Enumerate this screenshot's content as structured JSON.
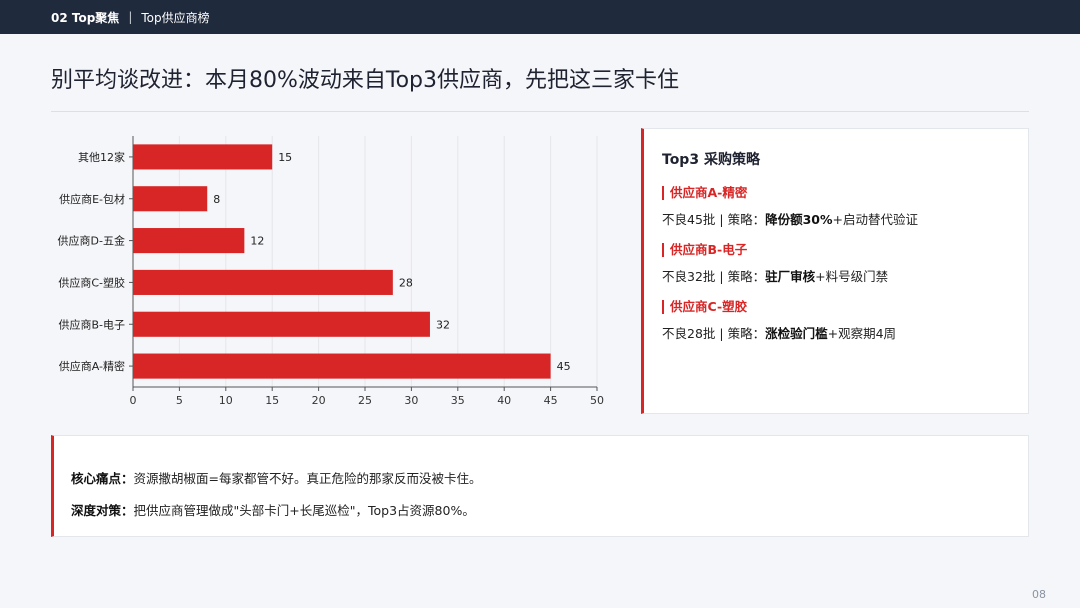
{
  "header": {
    "section": "02 Top聚焦",
    "separator": "|",
    "subtitle": "Top供应商榜"
  },
  "title": "别平均谈改进：本月80%波动来自Top3供应商，先把这三家卡住",
  "chart_data": {
    "type": "bar",
    "orientation": "horizontal",
    "categories": [
      "其他12家",
      "供应商E-包材",
      "供应商D-五金",
      "供应商C-塑胶",
      "供应商B-电子",
      "供应商A-精密"
    ],
    "values": [
      15,
      8,
      12,
      28,
      32,
      45
    ],
    "xlim": [
      0,
      50
    ],
    "xticks": [
      0,
      5,
      10,
      15,
      20,
      25,
      30,
      35,
      40,
      45,
      50
    ],
    "grid": "vertical",
    "bar_color": "#d82626",
    "title": "",
    "xlabel": "",
    "ylabel": ""
  },
  "strategy": {
    "title": "Top3 采购策略",
    "items": [
      {
        "name": "供应商A-精密",
        "prefix": "不良45批 | 策略：",
        "bold": "降份额30%",
        "suffix": "+启动替代验证"
      },
      {
        "name": "供应商B-电子",
        "prefix": "不良32批 | 策略：",
        "bold": "驻厂审核",
        "suffix": "+料号级门禁"
      },
      {
        "name": "供应商C-塑胶",
        "prefix": "不良28批 | 策略：",
        "bold": "涨检验门槛",
        "suffix": "+观察期4周"
      }
    ]
  },
  "insight": {
    "pain_label": "核心痛点：",
    "pain_text": "资源撒胡椒面=每家都管不好。真正危险的那家反而没被卡住。",
    "action_label": "深度对策：",
    "action_text": "把供应商管理做成\"头部卡门+长尾巡检\"，Top3占资源80%。"
  },
  "page_number": "08",
  "colors": {
    "accent": "#d82626",
    "topbar": "#1f2a3c",
    "background": "#f5f6f9"
  }
}
